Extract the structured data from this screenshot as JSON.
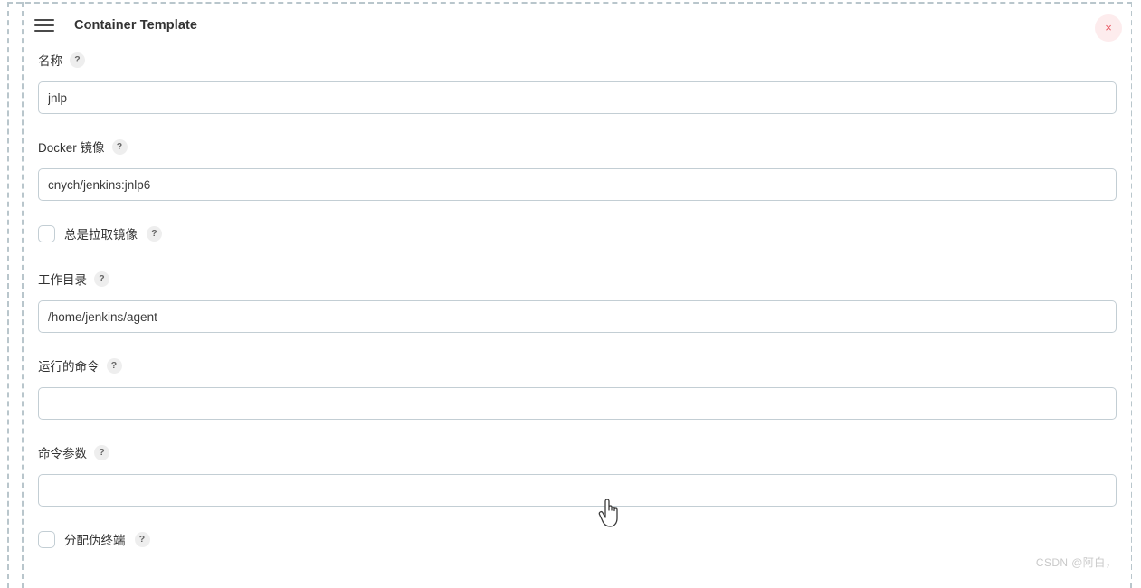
{
  "header": {
    "menu_icon": "hamburger-icon",
    "title": "Container Template",
    "close_icon": "×"
  },
  "help_badge_text": "?",
  "form": {
    "fields": [
      {
        "id": "name",
        "label": "名称",
        "help": "?",
        "type": "text",
        "value": "jnlp",
        "placeholder": ""
      },
      {
        "id": "docker-image",
        "label": "Docker 镜像",
        "help": "?",
        "type": "text",
        "value": "cnych/jenkins:jnlp6",
        "placeholder": ""
      },
      {
        "id": "always-pull-image",
        "label": "总是拉取镜像",
        "help": "?",
        "type": "checkbox",
        "checked": false
      },
      {
        "id": "working-directory",
        "label": "工作目录",
        "help": "?",
        "type": "text",
        "value": "/home/jenkins/agent",
        "placeholder": ""
      },
      {
        "id": "run-command",
        "label": "运行的命令",
        "help": "?",
        "type": "text",
        "value": "",
        "placeholder": ""
      },
      {
        "id": "command-arguments",
        "label": "命令参数",
        "help": "?",
        "type": "text",
        "value": "",
        "placeholder": ""
      },
      {
        "id": "allocate-pseudo-tty",
        "label": "分配伪终端",
        "help": "?",
        "type": "checkbox",
        "checked": false
      }
    ]
  },
  "watermark": "CSDN @阿白，",
  "colors": {
    "accent_close_bg": "#fdeced",
    "accent_close_fg": "#e8555f",
    "input_border": "#c3ced4",
    "dashed_guide": "#b9c6cc",
    "text": "#333333"
  }
}
